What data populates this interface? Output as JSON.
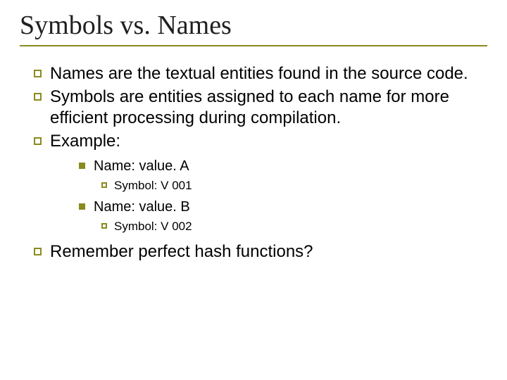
{
  "title": "Symbols vs. Names",
  "bullets": [
    "Names are the textual entities found in the source code.",
    "Symbols are entities assigned to each name for more efficient processing during compilation.",
    "Example:"
  ],
  "examples": [
    {
      "name": "Name: value. A",
      "symbol": "Symbol: V 001"
    },
    {
      "name": "Name: value. B",
      "symbol": "Symbol: V 002"
    }
  ],
  "closing": "Remember perfect hash functions?"
}
